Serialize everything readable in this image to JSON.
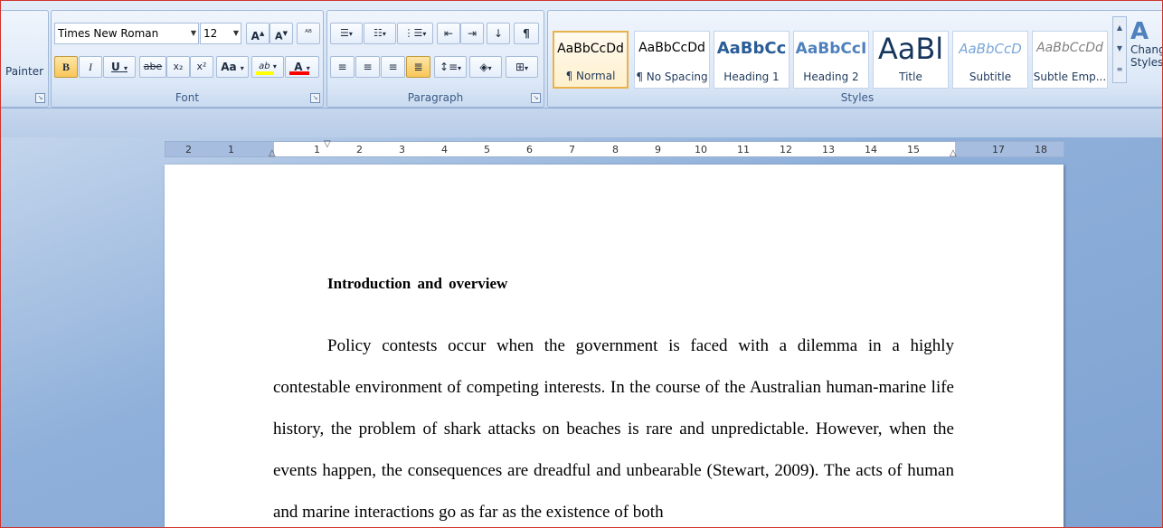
{
  "clipboard": {
    "painter_label": "Painter"
  },
  "font": {
    "group_label": "Font",
    "font_name": "Times New Roman",
    "font_size": "12",
    "grow_label": "A",
    "shrink_label": "A",
    "clear_label": "ᴬᴮ",
    "bold": "B",
    "italic": "I",
    "underline": "U",
    "strike": "abe",
    "subscript": "x₂",
    "superscript": "x²",
    "change_case": "Aa",
    "highlight": "ab",
    "font_color": "A",
    "highlight_color": "#ffff00",
    "font_color_value": "#ff0000"
  },
  "paragraph": {
    "group_label": "Paragraph",
    "pilcrow": "¶"
  },
  "styles": {
    "group_label": "Styles",
    "tiles": [
      {
        "sample": "AaBbCcDd",
        "name": "¶ Normal"
      },
      {
        "sample": "AaBbCcDd",
        "name": "¶ No Spacing"
      },
      {
        "sample": "AaBbCc",
        "name": "Heading 1"
      },
      {
        "sample": "AaBbCcI",
        "name": "Heading 2"
      },
      {
        "sample": "AaBl",
        "name": "Title"
      },
      {
        "sample": "AaBbCcD",
        "name": "Subtitle"
      },
      {
        "sample": "AaBbCcDd",
        "name": "Subtle Emp..."
      }
    ],
    "change_styles_line1": "Chang",
    "change_styles_line2": "Styles",
    "accent": "#e8b34b"
  },
  "ruler": {
    "left_numbers": [
      "2",
      "1"
    ],
    "numbers": [
      "1",
      "2",
      "3",
      "4",
      "5",
      "6",
      "7",
      "8",
      "9",
      "10",
      "11",
      "12",
      "13",
      "14",
      "15"
    ],
    "right_numbers": [
      "17",
      "18"
    ]
  },
  "document": {
    "heading": "Introduction and overview",
    "paragraph": "Policy contests occur when the government is faced with a dilemma in a highly contestable environment of competing interests. In the course of the Australian human-marine life history, the problem of shark attacks on beaches is rare and unpredictable. However, when the events happen, the consequences are dreadful and unbearable (Stewart, 2009). The acts of human and marine interactions go as far as the existence of both"
  }
}
